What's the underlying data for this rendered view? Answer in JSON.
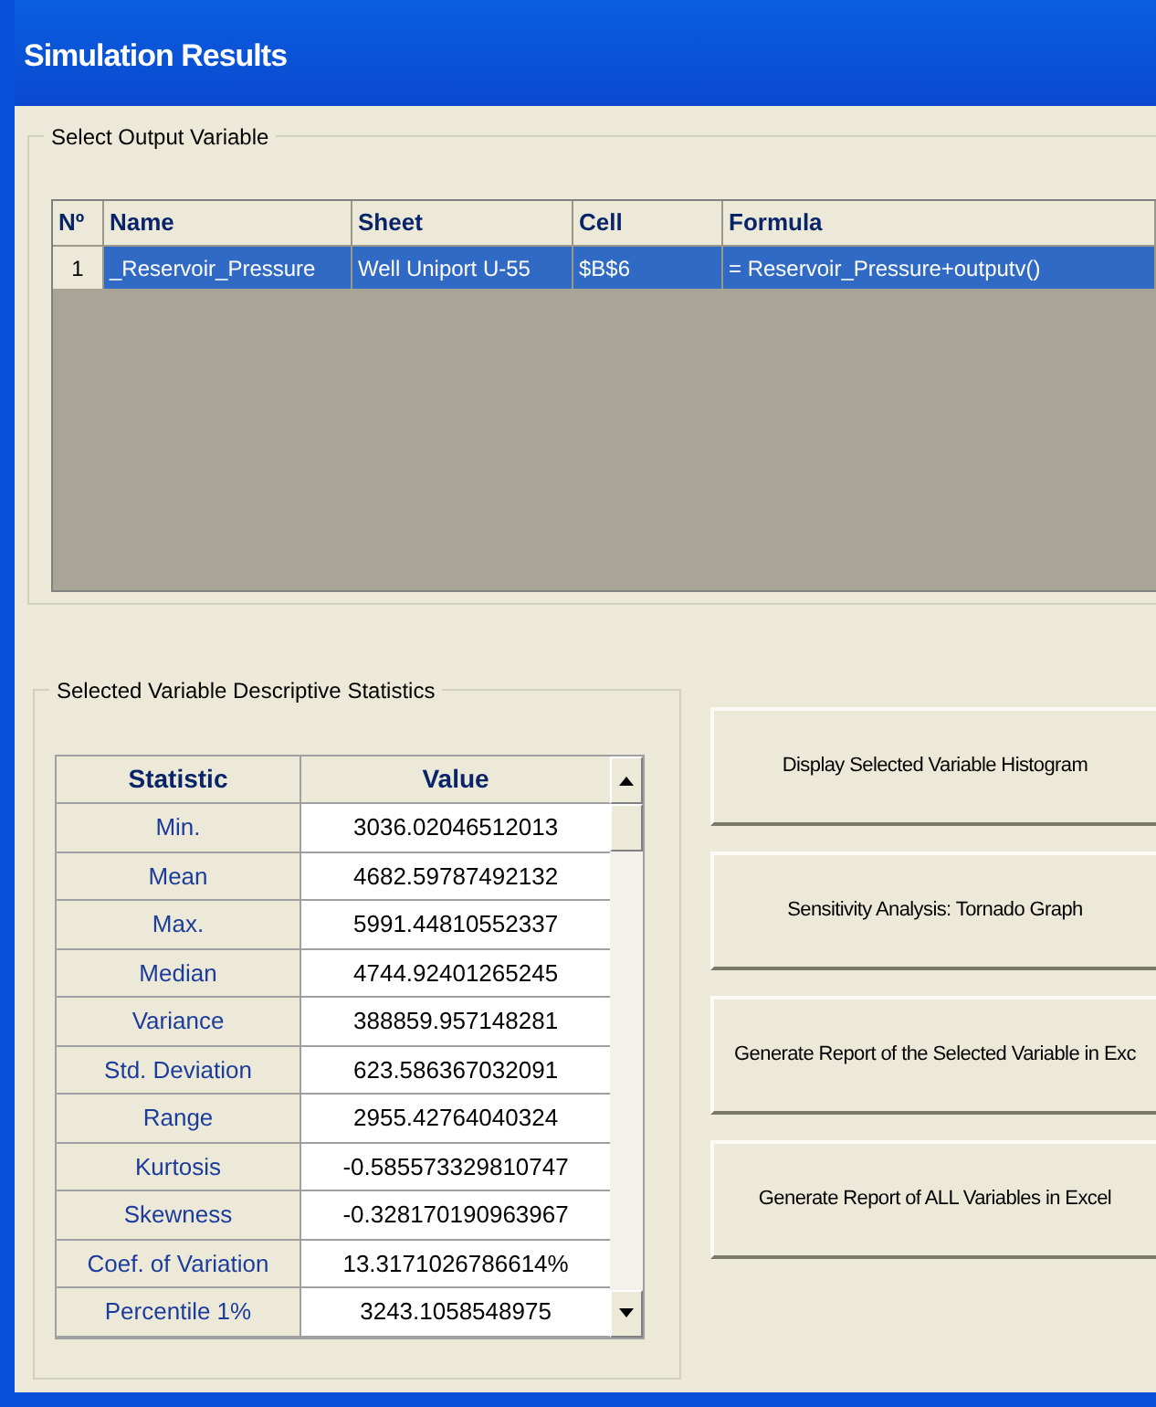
{
  "window": {
    "title": "Simulation Results"
  },
  "output_variable": {
    "title": "Select Output Variable",
    "columns": [
      "Nº",
      "Name",
      "Sheet",
      "Cell",
      "Formula"
    ],
    "rows": [
      {
        "cells": [
          "1",
          "_Reservoir_Pressure",
          "Well Uniport U-55",
          "$B$6",
          "= Reservoir_Pressure+outputv()"
        ],
        "selected": true
      }
    ]
  },
  "statistics": {
    "title": "Selected Variable Descriptive Statistics",
    "columns": [
      "Statistic",
      "Value"
    ],
    "rows": [
      [
        "Min.",
        "3036.02046512013"
      ],
      [
        "Mean",
        "4682.59787492132"
      ],
      [
        "Max.",
        "5991.44810552337"
      ],
      [
        "Median",
        "4744.92401265245"
      ],
      [
        "Variance",
        "388859.957148281"
      ],
      [
        "Std. Deviation",
        "623.586367032091"
      ],
      [
        "Range",
        "2955.42764040324"
      ],
      [
        "Kurtosis",
        "-0.585573329810747"
      ],
      [
        "Skewness",
        "-0.328170190963967"
      ],
      [
        "Coef. of Variation",
        "13.3171026786614%"
      ],
      [
        "Percentile 1%",
        "3243.1058548975"
      ]
    ]
  },
  "buttons": [
    "Display Selected Variable Histogram",
    "Sensitivity Analysis: Tornado Graph",
    "Generate Report of the Selected Variable in Exc",
    "Generate Report of ALL Variables in Excel"
  ]
}
